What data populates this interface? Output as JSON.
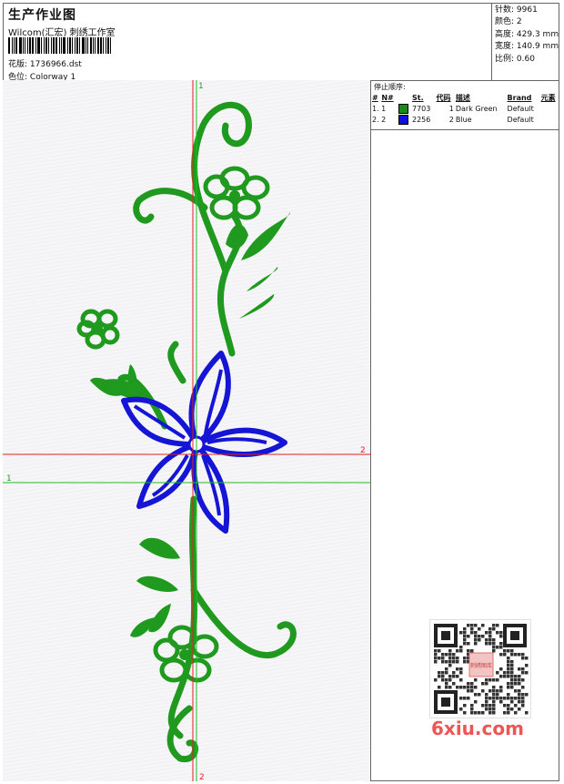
{
  "header": {
    "title": "生产作业图",
    "studio": "Wilcom(汇宏) 刺绣工作室",
    "design_label": "花版:",
    "design_file": "1736966.dst",
    "colorway_label": "色位:",
    "colorway": "Colorway 1"
  },
  "stats": {
    "stitches_label": "针数:",
    "stitches": "9961",
    "colors_label": "颜色:",
    "colors": "2",
    "height_label": "高度:",
    "height": "429.3 mm",
    "width_label": "宽度:",
    "width": "140.9 mm",
    "scale_label": "比例:",
    "scale": "0.60"
  },
  "stop_sequence": {
    "title": "停止顺序:",
    "headers": [
      "#",
      "N#",
      "St.",
      "代码",
      "描述",
      "Brand",
      "元素"
    ],
    "rows": [
      {
        "index": "1. 1",
        "color": "#1b8a1b",
        "stitches": "7703",
        "code": "1",
        "description": "Dark Green",
        "brand": "Default"
      },
      {
        "index": "2. 2",
        "color": "#1010d8",
        "stitches": "2256",
        "code": "2",
        "description": "Blue",
        "brand": "Default"
      }
    ]
  },
  "axes": {
    "v1_top": "1",
    "v1_bottom": "2",
    "h1": "1",
    "h2": "2"
  },
  "colors": {
    "green_thread": "#1f9a1f",
    "blue_thread": "#1515d5",
    "axis_red": "#e02020",
    "axis_green": "#20c020"
  },
  "watermark": {
    "qr_caption": "刺绣图库",
    "site": "6xiu.com"
  }
}
